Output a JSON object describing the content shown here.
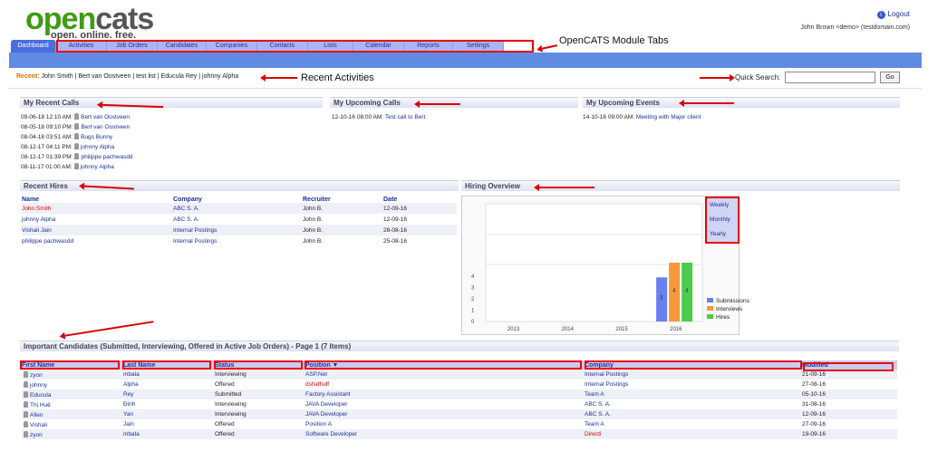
{
  "logo": {
    "word_open": "open",
    "word_cats": "cats",
    "tagline": "open. online. free."
  },
  "header": {
    "logout": "Logout",
    "user": "John Brown <demo> (testdomain.com)"
  },
  "tabs": [
    "Dashboard",
    "Activities",
    "Job Orders",
    "Candidates",
    "Companies",
    "Contacts",
    "Lists",
    "Calendar",
    "Reports",
    "Settings"
  ],
  "annotations": {
    "tabs": "OpenCATS Module Tabs",
    "recent": "Recent Activities"
  },
  "recent": {
    "label": "Recent:",
    "items": [
      "John Smith",
      "Bert van Oostveen",
      "test list",
      "Educula Rey",
      "johnny Alpha"
    ]
  },
  "quick_search": {
    "label": "Quick Search:",
    "value": "",
    "go": "Go"
  },
  "recent_calls": {
    "title": "My Recent Calls",
    "items": [
      {
        "time": "09-06-18 12:10 AM:",
        "name": "Bert van Oostveen"
      },
      {
        "time": "08-05-18 09:10 PM:",
        "name": "Bert van Oostveen"
      },
      {
        "time": "08-04-18 03:51 AM:",
        "name": "Bugs Bunny"
      },
      {
        "time": "08-12-17 04:11 PM:",
        "name": "johnny Alpha"
      },
      {
        "time": "08-12-17 01:39 PM:",
        "name": "philippe pachwasdd"
      },
      {
        "time": "08-11-17 01:00 AM:",
        "name": "johnny Alpha"
      }
    ]
  },
  "upcoming_calls": {
    "title": "My Upcoming Calls",
    "items": [
      {
        "time": "12-10-16 08:00 AM:",
        "name": "Test call to Bert"
      }
    ]
  },
  "upcoming_events": {
    "title": "My Upcoming Events",
    "items": [
      {
        "time": "14-10-16 09:00 AM:",
        "name": "Meeting with Major client"
      }
    ]
  },
  "recent_hires": {
    "title": "Recent Hires",
    "columns": [
      "Name",
      "Company",
      "Recruiter",
      "Date"
    ],
    "rows": [
      [
        "John Smith",
        "ABC S. A.",
        "John B.",
        "12-09-16"
      ],
      [
        "johnny Alpha",
        "ABC S. A.",
        "John B.",
        "12-09-16"
      ],
      [
        "Vishali Jain",
        "Internal Postings",
        "John B.",
        "28-08-16"
      ],
      [
        "philippe pachwasdd",
        "Internal Postings",
        "John B.",
        "25-08-16"
      ]
    ]
  },
  "hiring_overview": {
    "title": "Hiring Overview",
    "periods": [
      "Weekly",
      "Monthly",
      "Yearly"
    ]
  },
  "chart_data": {
    "type": "bar",
    "categories": [
      "2013",
      "2014",
      "2015",
      "2016"
    ],
    "series": [
      {
        "name": "Submissions",
        "values": [
          0,
          0,
          0,
          3
        ],
        "color": "#6b7ff0"
      },
      {
        "name": "Interviews",
        "values": [
          0,
          0,
          0,
          4
        ],
        "color": "#f59a3a"
      },
      {
        "name": "Hires",
        "values": [
          0,
          0,
          0,
          4
        ],
        "color": "#4ccb4c"
      }
    ],
    "yticks": [
      "0",
      "1",
      "2",
      "3",
      "4"
    ],
    "ylim": [
      0,
      4
    ],
    "legend": "right"
  },
  "candidates": {
    "title": "Important Candidates (Submitted, Interviewing, Offered in Active Job Orders) - Page 1 (7 Items)",
    "columns": [
      "First Name",
      "Last Name",
      "Status",
      "Position ▼",
      "Company",
      "Modified"
    ],
    "rows": [
      [
        "zyon",
        "mbala",
        "Interviewing",
        "ASP.Net",
        "Internal Postings",
        "21-09-16"
      ],
      [
        "johnny",
        "Alpha",
        "Offered",
        "dsfsdfsdf",
        "Internal Postings",
        "27-08-16"
      ],
      [
        "Educula",
        "Rey",
        "Submitted",
        "Factory Assistant",
        "Team A",
        "05-10-16"
      ],
      [
        "Thị Huệ",
        "Đinh",
        "Interviewing",
        "JAVA Developer",
        "ABC S. A.",
        "31-08-16"
      ],
      [
        "Allen",
        "Yan",
        "Interviewing",
        "JAVA Developer",
        "ABC S. A.",
        "12-09-16"
      ],
      [
        "Vishali",
        "Jain",
        "Offered",
        "Position A",
        "Team A",
        "27-09-16"
      ],
      [
        "zyon",
        "mbala",
        "Offered",
        "Software Developer",
        "Directi",
        "19-09-16"
      ]
    ]
  },
  "colors": {
    "accent": "#5f8be3",
    "annotation": "#dd0000",
    "link": "#1a2f9c"
  }
}
